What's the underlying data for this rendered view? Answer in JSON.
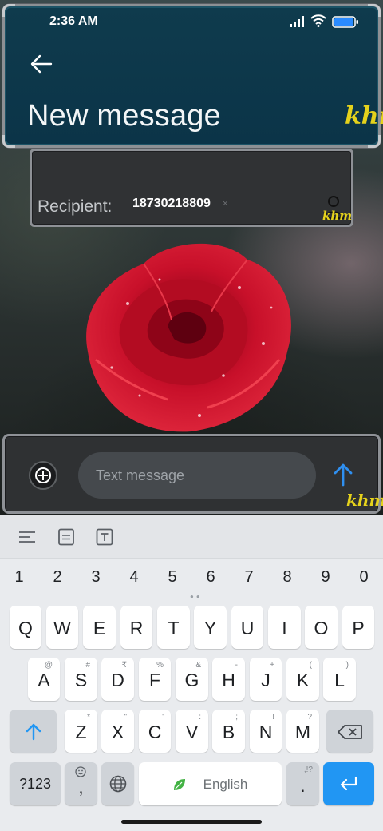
{
  "status_bar": {
    "time": "2:36 AM"
  },
  "header": {
    "title": "New message",
    "watermark": "khm"
  },
  "recipient": {
    "label": "Recipient:",
    "chip_text": "18730218809",
    "chip_close": "×",
    "watermark": "khm"
  },
  "compose": {
    "placeholder": "Text message",
    "watermark": "khm"
  },
  "keyboard": {
    "numbers": [
      "1",
      "2",
      "3",
      "4",
      "5",
      "6",
      "7",
      "8",
      "9",
      "0"
    ],
    "row1": [
      {
        "main": "Q",
        "hint": ""
      },
      {
        "main": "W",
        "hint": ""
      },
      {
        "main": "E",
        "hint": ""
      },
      {
        "main": "R",
        "hint": ""
      },
      {
        "main": "T",
        "hint": ""
      },
      {
        "main": "Y",
        "hint": ""
      },
      {
        "main": "U",
        "hint": ""
      },
      {
        "main": "I",
        "hint": ""
      },
      {
        "main": "O",
        "hint": ""
      },
      {
        "main": "P",
        "hint": ""
      }
    ],
    "row2": [
      {
        "main": "A",
        "hint": "@"
      },
      {
        "main": "S",
        "hint": "#"
      },
      {
        "main": "D",
        "hint": "₹"
      },
      {
        "main": "F",
        "hint": "%"
      },
      {
        "main": "G",
        "hint": "&"
      },
      {
        "main": "H",
        "hint": "-"
      },
      {
        "main": "J",
        "hint": "+"
      },
      {
        "main": "K",
        "hint": "("
      },
      {
        "main": "L",
        "hint": ")"
      }
    ],
    "row3": [
      {
        "main": "Z",
        "hint": "*"
      },
      {
        "main": "X",
        "hint": "\""
      },
      {
        "main": "C",
        "hint": "'"
      },
      {
        "main": "V",
        "hint": ":"
      },
      {
        "main": "B",
        "hint": ";"
      },
      {
        "main": "N",
        "hint": "!"
      },
      {
        "main": "M",
        "hint": "?"
      }
    ],
    "symbols_label": "?123",
    "comma": ",",
    "space_label": "English",
    "period": ".",
    "period_hint": ",!?",
    "colors": {
      "accent": "#2196f3",
      "key": "#ffffff",
      "key_dark": "#cfd3d8"
    }
  }
}
